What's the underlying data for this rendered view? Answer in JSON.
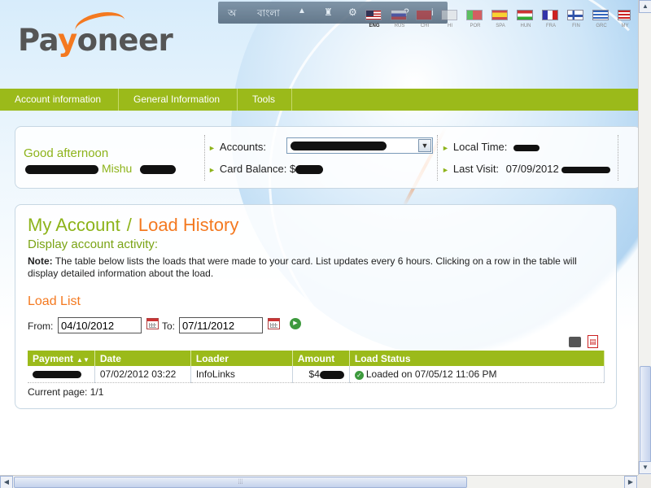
{
  "brand": {
    "logo_prefix": "Pa",
    "logo_y": "y",
    "logo_suffix": "oneer",
    "accent_green": "#9bba1a",
    "accent_orange": "#f47920"
  },
  "topbar": {
    "items": [
      "অ",
      "বাংলা",
      "▲",
      "♜",
      "⚙",
      "◐",
      "?",
      "i"
    ],
    "flags": [
      {
        "code": "ENG",
        "active": true
      },
      {
        "code": "RUS"
      },
      {
        "code": "CHI"
      },
      {
        "code": "HI"
      },
      {
        "code": "POR"
      },
      {
        "code": "SPA"
      },
      {
        "code": "HUN"
      },
      {
        "code": "FRA"
      },
      {
        "code": "FIN"
      },
      {
        "code": "GRC"
      },
      {
        "code": "MY"
      }
    ]
  },
  "nav": {
    "items": [
      "Account information",
      "General Information",
      "Tools"
    ]
  },
  "welcome": {
    "greeting": "Good afternoon",
    "name_visible": "Mishu",
    "accounts_label": "Accounts:",
    "card_balance_label": "Card Balance:",
    "card_balance_prefix": "$",
    "local_time_label": "Local Time:",
    "last_visit_label": "Last Visit:",
    "last_visit_value": "07/09/2012"
  },
  "page": {
    "title_part1": "My Account",
    "title_sep": "/",
    "title_part2": "Load History",
    "subtitle": "Display account activity:",
    "note_label": "Note:",
    "note_text": "The table below lists the loads that were made to your card. List updates every 6 hours. Clicking on a row in the table will display detailed information about the load.",
    "section_title": "Load List",
    "from_label": "From:",
    "from_value": "04/10/2012",
    "to_label": "To:",
    "to_value": "07/11/2012"
  },
  "table": {
    "headers": [
      "Payment",
      "Date",
      "Loader",
      "Amount",
      "Load Status"
    ],
    "rows": [
      {
        "date": "07/02/2012 03:22",
        "loader": "InfoLinks",
        "amount_prefix": "$4",
        "status": "Loaded on 07/05/12 11:06 PM"
      }
    ],
    "current_page": "Current page: 1/1"
  }
}
